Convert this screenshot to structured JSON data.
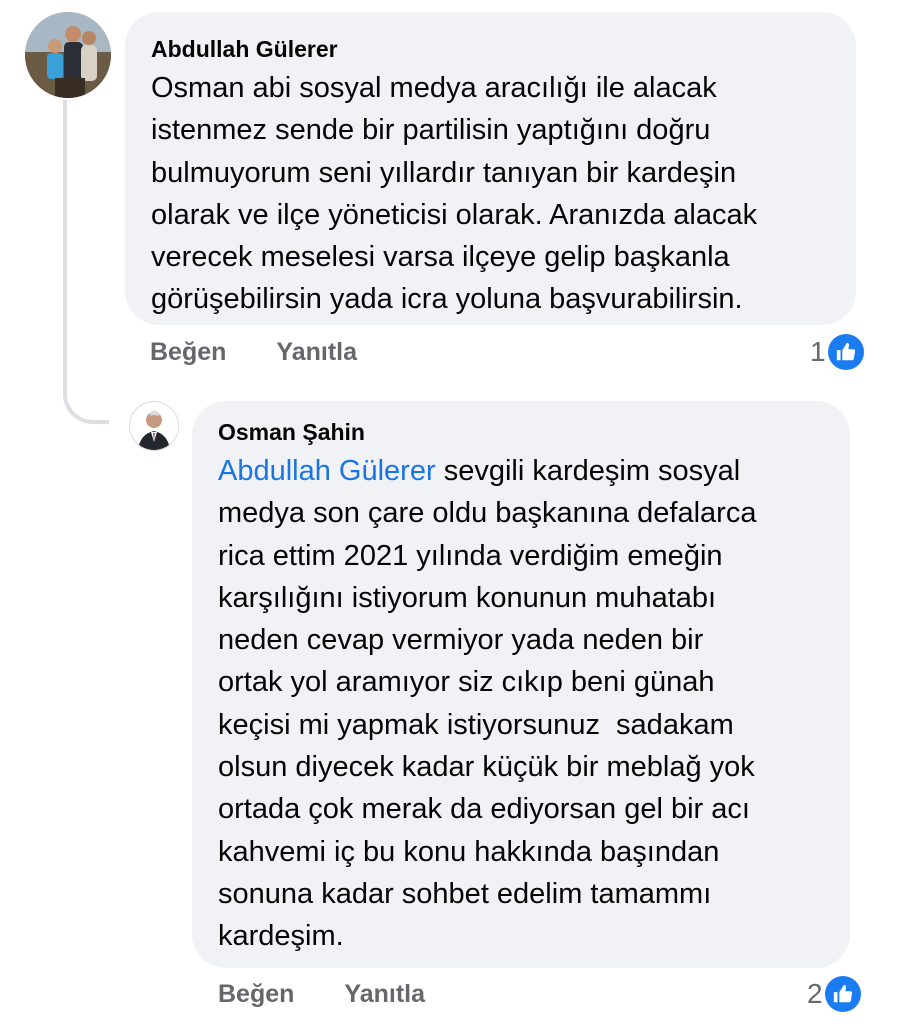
{
  "comments": [
    {
      "author": "Abdullah Gülerer",
      "text_lines": [
        "Osman abi sosyal medya aracılığı ile alacak",
        "istenmez sende bir partilisin yaptığını doğru",
        "bulmuyorum seni yıllardır tanıyan bir kardeşin",
        "olarak ve ilçe yöneticisi olarak. Aranızda alacak",
        "verecek meselesi varsa ilçeye gelip başkanla",
        "görüşebilirsin yada icra yoluna başvurabilirsin."
      ],
      "like_label": "Beğen",
      "reply_label": "Yanıtla",
      "reaction_count": "1",
      "reaction_icon": "like-icon"
    },
    {
      "author": "Osman Şahin",
      "mention": "Abdullah Gülerer",
      "first_line_rest": " sevgili kardeşim sosyal",
      "text_lines": [
        "medya son çare oldu başkanına defalarca",
        "rica ettim 2021 yılında verdiğim emeğin",
        "karşılığını istiyorum konunun muhatabı",
        "neden cevap vermiyor yada neden bir",
        "ortak yol aramıyor siz cıkıp beni günah",
        "keçisi mi yapmak istiyorsunuz  sadakam",
        "olsun diyecek kadar küçük bir meblağ yok",
        "ortada çok merak da ediyorsan gel bir acı",
        "kahvemi iç bu konu hakkında başından",
        "sonuna kadar sohbet edelim tamammı",
        "kardeşim."
      ],
      "like_label": "Beğen",
      "reply_label": "Yanıtla",
      "reaction_count": "2",
      "reaction_icon": "like-icon"
    }
  ],
  "colors": {
    "bubble": "#f0f2f5",
    "mention": "#1b74e4",
    "action_text": "#65676b",
    "like_badge": "#1b7cf2",
    "thread_line": "#dcdee3"
  }
}
